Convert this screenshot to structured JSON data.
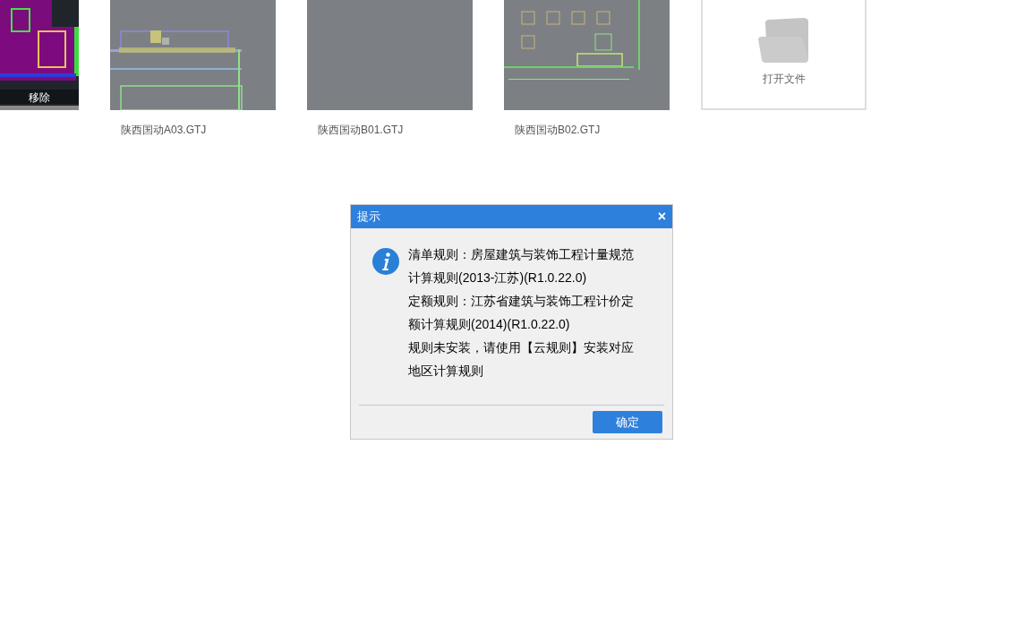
{
  "files": [
    {
      "overlay": "移除",
      "kind": "dark"
    },
    {
      "name": "陕西国动A03.GTJ",
      "kind": "plan"
    },
    {
      "name": "陕西国动B01.GTJ",
      "kind": "empty"
    },
    {
      "name": "陕西国动B02.GTJ",
      "kind": "grid"
    }
  ],
  "open_file": {
    "label": "打开文件"
  },
  "dialog": {
    "title": "提示",
    "close": "×",
    "message_lines": [
      "清单规则：房屋建筑与装饰工程计量规范",
      "计算规则(2013-江苏)(R1.0.22.0)",
      "定额规则：江苏省建筑与装饰工程计价定",
      "额计算规则(2014)(R1.0.22.0)",
      "规则未安装，请使用【云规则】安装对应",
      "地区计算规则"
    ],
    "ok_button": "确定"
  }
}
